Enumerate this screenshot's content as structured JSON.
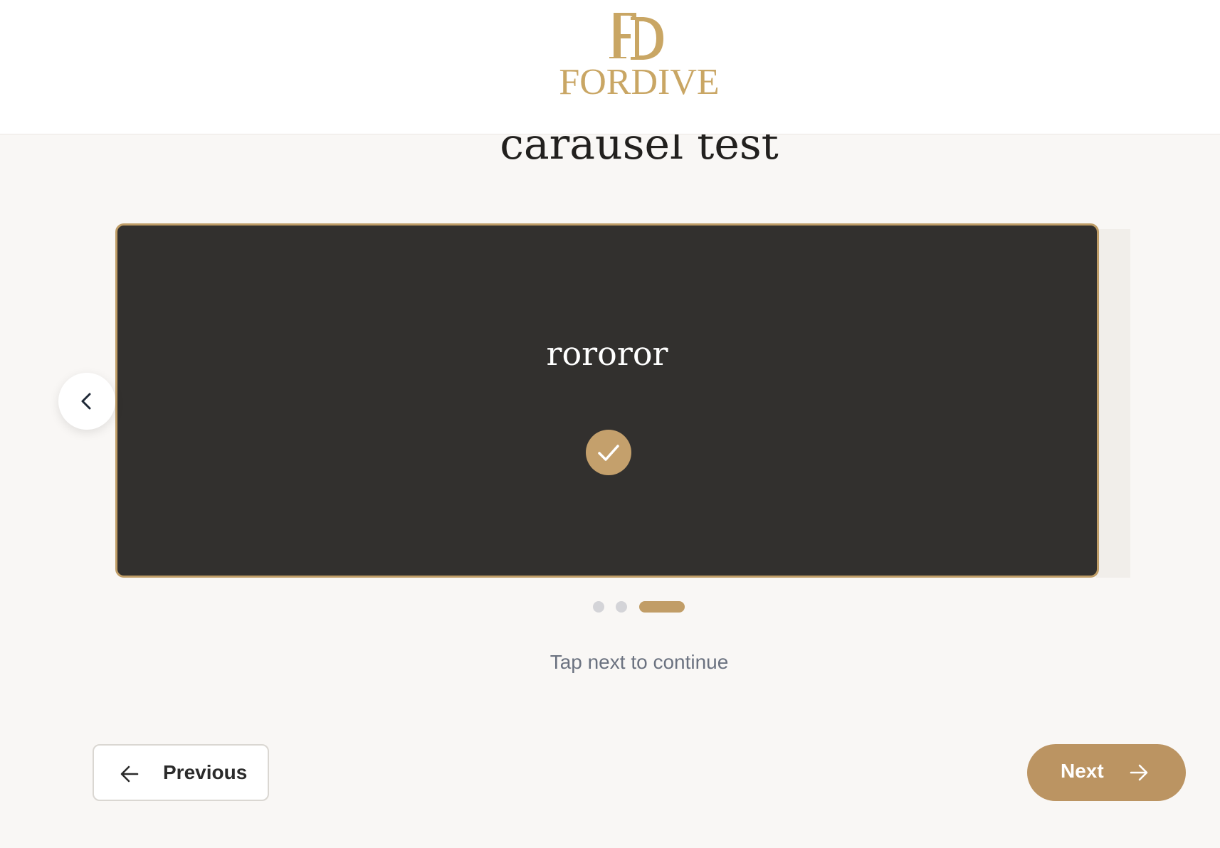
{
  "header": {
    "logo_monogram": "FD",
    "logo_text": "FORDIVE"
  },
  "page": {
    "title": "carausel test"
  },
  "carousel": {
    "slide_title": "rororor",
    "slide_selected": true,
    "total_slides": 3,
    "current_slide": 3,
    "hint": "Tap next to continue"
  },
  "navigation": {
    "previous_label": "Previous",
    "next_label": "Next"
  },
  "icons": {
    "logo": "fordive-logo",
    "carousel_prev": "chevron-left-icon",
    "selected": "check-icon",
    "previous": "arrow-left-icon",
    "next": "arrow-right-icon"
  },
  "colors": {
    "brand_gold": "#c9a664",
    "card_background": "#32302e",
    "card_border": "#bf9d67",
    "next_button": "#bb9462",
    "page_background": "#f9f7f5",
    "dot_inactive": "#d4d4d8"
  }
}
